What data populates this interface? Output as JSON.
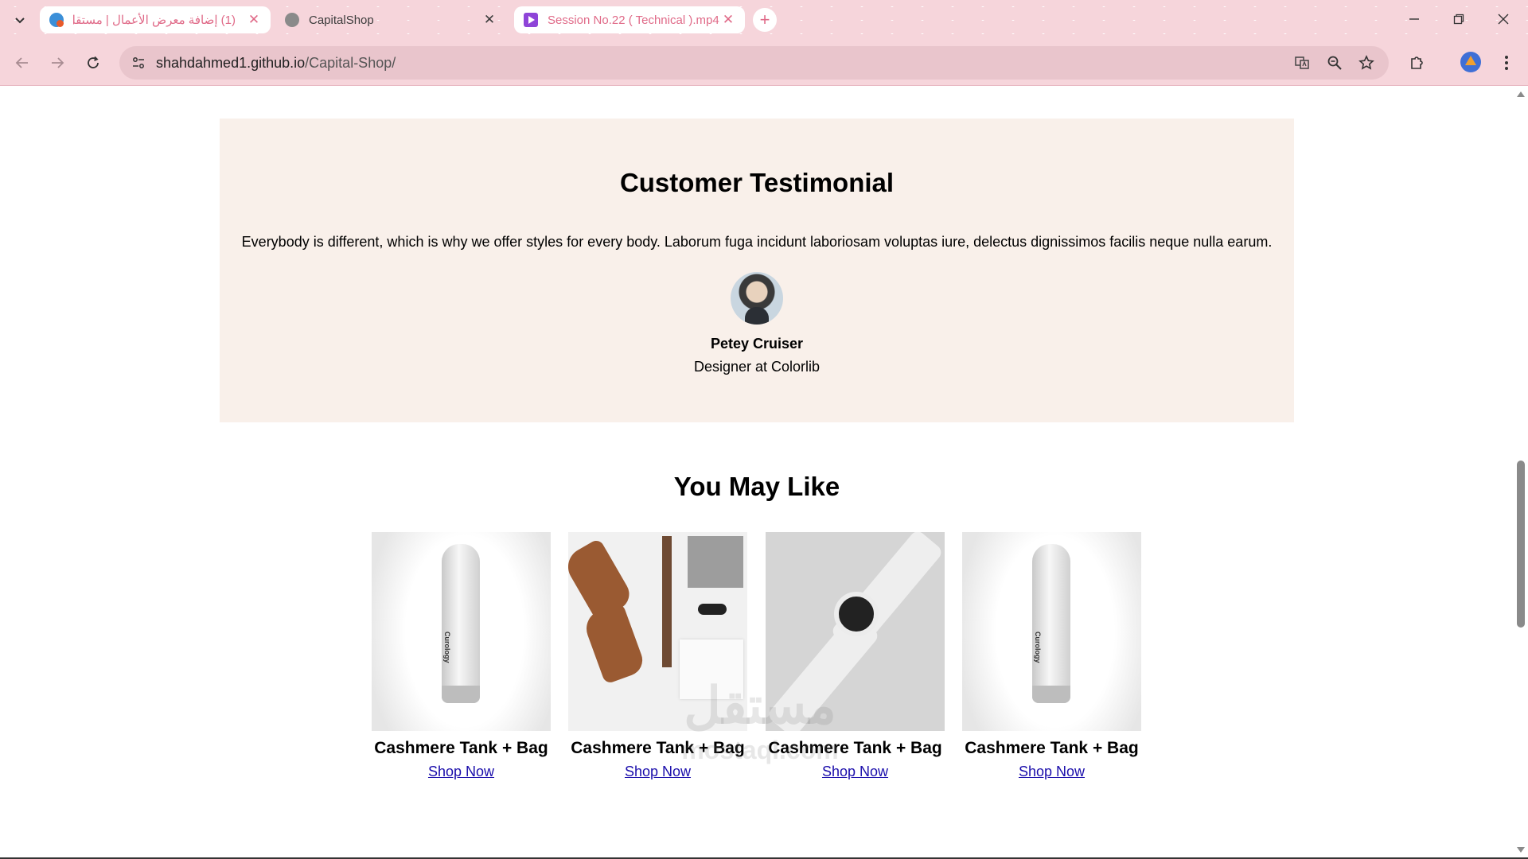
{
  "browser": {
    "tabs": [
      {
        "title": "(1) إضافة معرض الأعمال | مستقل",
        "state": "active",
        "favicon": "mostaql-icon"
      },
      {
        "title": "CapitalShop",
        "state": "inactive",
        "favicon": "globe-icon"
      },
      {
        "title": "Session No.22 ( Technical ).mp4",
        "state": "active",
        "favicon": "video-icon"
      }
    ],
    "new_tab_label": "+",
    "address": {
      "host": "shahdahmed1.github.io",
      "path": "/Capital-Shop/"
    },
    "colors": {
      "chrome_bg": "#f6d5db",
      "active_tab_text": "#e06a88",
      "omnibox_bg": "#e9c5cc"
    }
  },
  "testimonial": {
    "title": "Customer Testimonial",
    "quote": "Everybody is different, which is why we offer styles for every body. Laborum fuga incidunt laboriosam voluptas iure, delectus dignissimos facilis neque nulla earum.",
    "author_name": "Petey Cruiser",
    "author_role": "Designer at Colorlib",
    "bg_color": "#f9f0ea"
  },
  "may_like": {
    "title": "You May Like",
    "products": [
      {
        "name": "Cashmere Tank + Bag",
        "link": "Shop Now",
        "image": "bottle",
        "brand": "Curology"
      },
      {
        "name": "Cashmere Tank + Bag",
        "link": "Shop Now",
        "image": "flatlay"
      },
      {
        "name": "Cashmere Tank + Bag",
        "link": "Shop Now",
        "image": "watch"
      },
      {
        "name": "Cashmere Tank + Bag",
        "link": "Shop Now",
        "image": "bottle",
        "brand": "Curology"
      }
    ]
  },
  "watermark": {
    "arabic": "مستقل",
    "latin": "mostaql.com"
  }
}
